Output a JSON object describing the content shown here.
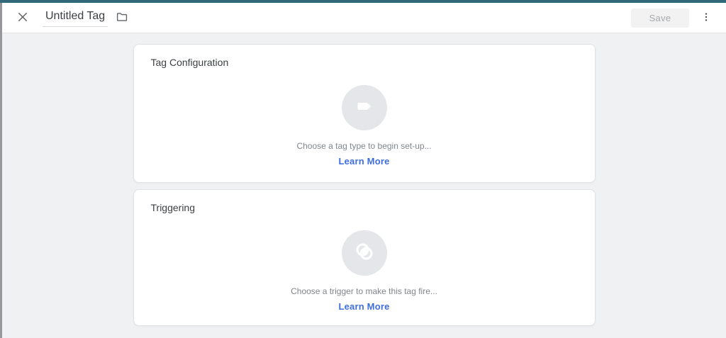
{
  "colors": {
    "topbar_accent": "#31687a",
    "content_bg": "#f0f1f2",
    "circle_bg": "#e4e6ea",
    "link_blue": "#3e6ede",
    "muted_text": "#80868b",
    "title_text": "#3c4043",
    "save_disabled_bg": "#f2f2f3",
    "save_disabled_text": "#a6a9ac"
  },
  "header": {
    "title_value": "Untitled Tag",
    "save_label": "Save",
    "close_icon": "close-icon",
    "folder_icon": "folder-icon",
    "menu_icon": "more-vert-icon"
  },
  "cards": {
    "tag_configuration": {
      "title": "Tag Configuration",
      "icon": "tag-icon",
      "hint": "Choose a tag type to begin set-up...",
      "link": "Learn More"
    },
    "triggering": {
      "title": "Triggering",
      "icon": "trigger-icon",
      "hint": "Choose a trigger to make this tag fire...",
      "link": "Learn More"
    }
  }
}
